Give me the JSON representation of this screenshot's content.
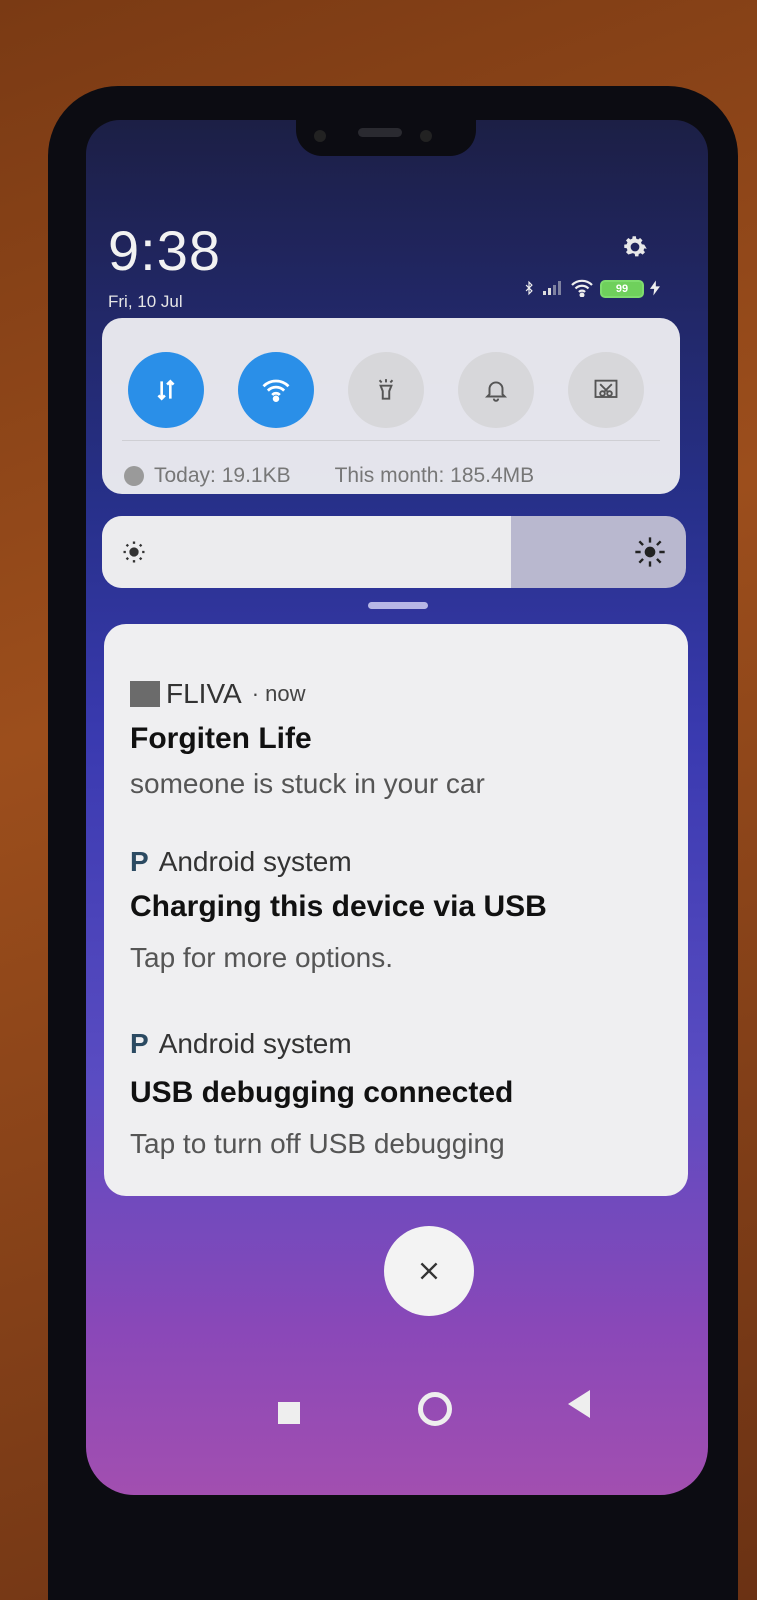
{
  "status_bar": {
    "time": "9:38",
    "date": "Fri, 10 Jul",
    "battery": "99"
  },
  "quick_settings": {
    "toggles": [
      {
        "name": "mobile-data",
        "state": "on"
      },
      {
        "name": "wifi",
        "state": "on"
      },
      {
        "name": "flashlight",
        "state": "off"
      },
      {
        "name": "sound",
        "state": "off"
      },
      {
        "name": "screenshot",
        "state": "off"
      }
    ],
    "data_today": "Today: 19.1KB",
    "data_month": "This month: 185.4MB"
  },
  "brightness": {
    "level": 0.7
  },
  "notifications": [
    {
      "app": "FLIVA",
      "time": "· now",
      "title": "Forgiten Life",
      "body": "someone is stuck in your car"
    },
    {
      "app": "Android system",
      "title": "Charging this device via USB",
      "body": "Tap for more options."
    },
    {
      "app": "Android system",
      "title": "USB debugging connected",
      "body": "Tap to turn off USB debugging"
    }
  ],
  "colors": {
    "toggle_on": "#2a8fe8",
    "accent_battery": "#6fd05c"
  }
}
